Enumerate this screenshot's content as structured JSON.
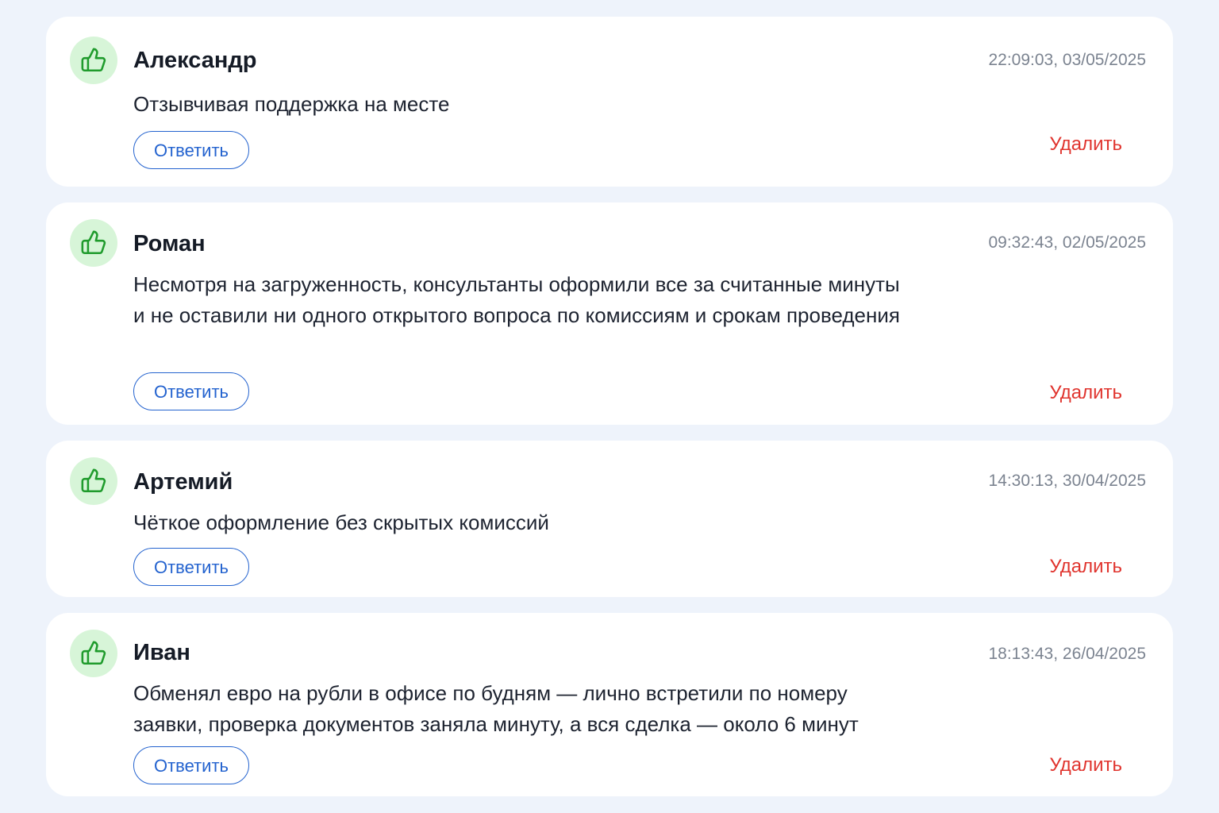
{
  "colors": {
    "page_background": "#eef3fb",
    "card_background": "#ffffff",
    "avatar_background": "#d7f5d8",
    "like_icon": "#1f9b2c",
    "reply_accent": "#2463cf",
    "delete_accent": "#e0342e",
    "timestamp": "#7b8390"
  },
  "icons": {
    "avatar": "thumbs-up-icon"
  },
  "actions": {
    "reply_label": "Ответить",
    "delete_label": "Удалить"
  },
  "reviews": [
    {
      "author": "Александр",
      "timestamp": "22:09:03, 03/05/2025",
      "text": "Отзывчивая поддержка на месте"
    },
    {
      "author": "Роман",
      "timestamp": "09:32:43, 02/05/2025",
      "text": "Несмотря на загруженность, консультанты оформили все за считанные минуты и не оставили ни одного открытого вопроса по комиссиям и срокам проведения"
    },
    {
      "author": "Артемий",
      "timestamp": "14:30:13, 30/04/2025",
      "text": "Чёткое оформление без скрытых комиссий"
    },
    {
      "author": "Иван",
      "timestamp": "18:13:43, 26/04/2025",
      "text": "Обменял евро на рубли в офисе по будням — лично встретили по номеру заявки, проверка документов заняла минуту, а вся сделка — около 6 минут"
    }
  ]
}
